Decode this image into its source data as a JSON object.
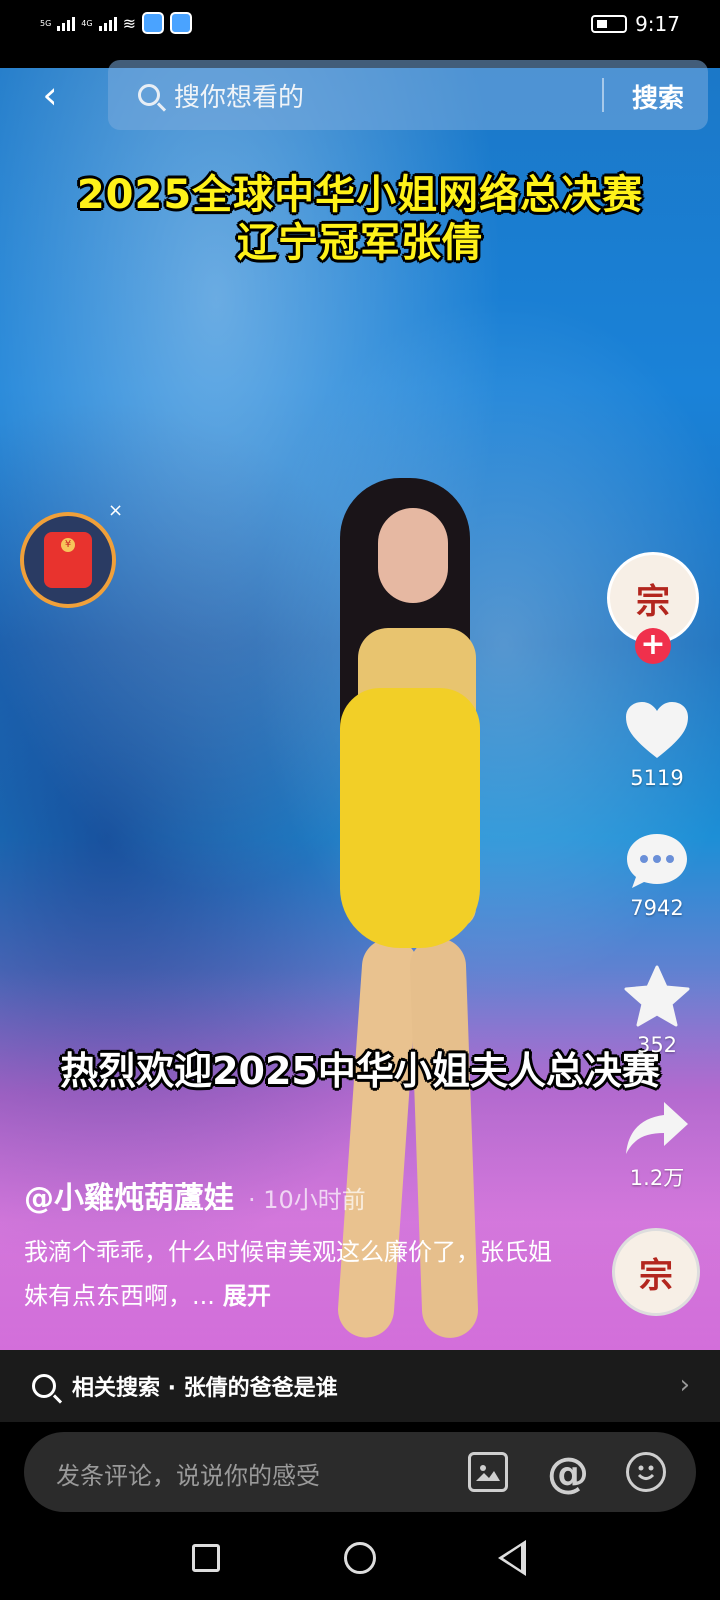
{
  "status_bar": {
    "network_1": "5G",
    "network_2": "4G",
    "battery": "",
    "time": "9:17"
  },
  "search": {
    "placeholder": "搜你想看的",
    "submit_label": "搜索"
  },
  "video": {
    "title_line1": "2025全球中华小姐网络总决赛",
    "title_line2": "辽宁冠军张倩",
    "overlay_text": "热烈欢迎2025中华小姐夫人总决赛"
  },
  "red_envelope": {
    "close_label": "×"
  },
  "side_actions": {
    "avatar_glyph": "宗",
    "follow_label": "+",
    "likes": "5119",
    "comments": "7942",
    "favorites": "352",
    "shares": "1.2万"
  },
  "author": {
    "name": "@小雞炖葫蘆娃",
    "time": "· 10小时前"
  },
  "caption": {
    "text": "我滴个乖乖，什么时候审美观这么廉价了，张氏姐妹有点东西啊，...",
    "expand": "展开"
  },
  "related_search": {
    "label": "相关搜索 · 张倩的爸爸是谁"
  },
  "comment_bar": {
    "placeholder": "发条评论，说说你的感受",
    "at_symbol": "@"
  },
  "colors": {
    "title_yellow": "#fff21a",
    "follow_red": "#f0304c",
    "envelope_red": "#e8332e"
  },
  "icons": [
    "back-icon",
    "search-icon",
    "heart-icon",
    "comment-icon",
    "star-icon",
    "share-icon",
    "image-icon",
    "at-icon",
    "emoji-icon",
    "chevron-right-icon"
  ]
}
